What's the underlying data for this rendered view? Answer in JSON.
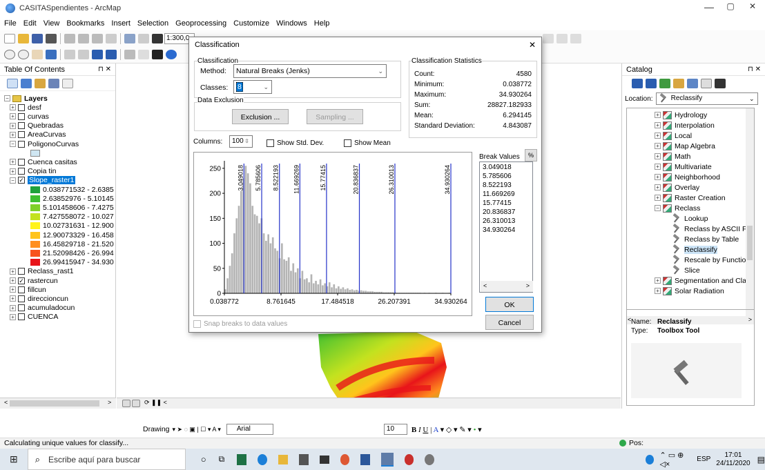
{
  "window": {
    "title": "CASITASpendientes - ArcMap",
    "min": "—",
    "max": "▢",
    "close": "✕"
  },
  "menu": [
    "File",
    "Edit",
    "View",
    "Bookmarks",
    "Insert",
    "Selection",
    "Geoprocessing",
    "Customize",
    "Windows",
    "Help"
  ],
  "toolbar": {
    "scale": "1:300,0"
  },
  "toc": {
    "title": "Table Of Contents",
    "pin": "⊓ ✕",
    "layers_label": "Layers",
    "items": [
      "desf",
      "curvas",
      "Quebradas",
      "AreaCurvas",
      "PoligonoCurvas",
      "Cuenca casitas",
      "Copia tin",
      "Slope_raster1"
    ],
    "legend": [
      {
        "label": "0.038771532 - 2.6385",
        "color": "#1fa23c"
      },
      {
        "label": "2.63852976 - 5.10145",
        "color": "#3fbf31"
      },
      {
        "label": "5.101458606 - 7.4275",
        "color": "#7fd02a"
      },
      {
        "label": "7.427558072 - 10.027",
        "color": "#c3e21f"
      },
      {
        "label": "10.02731631 - 12.900",
        "color": "#fff31a"
      },
      {
        "label": "12.90073329 - 16.458",
        "color": "#ffc41c"
      },
      {
        "label": "16.45829718 - 21.520",
        "color": "#ff8e1f"
      },
      {
        "label": "21.52098426 - 26.994",
        "color": "#f8521d"
      },
      {
        "label": "26.99415947 - 34.930",
        "color": "#e8141a"
      }
    ],
    "more": [
      "Reclass_rast1",
      "rastercun",
      "fillcun",
      "direccioncun",
      "acumuladocun",
      "CUENCA"
    ]
  },
  "dialog": {
    "title": "Classification",
    "close": "✕",
    "classification_group": "Classification",
    "method_label": "Method:",
    "method_value": "Natural Breaks (Jenks)",
    "classes_label": "Classes:",
    "classes_value": "8",
    "exclusion_group": "Data Exclusion",
    "exclusion_btn": "Exclusion ...",
    "sampling_btn": "Sampling ...",
    "stats_group": "Classification Statistics",
    "stats": [
      {
        "k": "Count:",
        "v": "4580"
      },
      {
        "k": "Minimum:",
        "v": "0.038772"
      },
      {
        "k": "Maximum:",
        "v": "34.930264"
      },
      {
        "k": "Sum:",
        "v": "28827.182933"
      },
      {
        "k": "Mean:",
        "v": "6.294145"
      },
      {
        "k": "Standard Deviation:",
        "v": "4.843087"
      }
    ],
    "columns_label": "Columns:",
    "columns_value": "100",
    "show_std_dev": "Show Std. Dev.",
    "show_mean": "Show Mean",
    "break_values_label": "Break Values",
    "pct_btn": "%",
    "break_values": [
      "3.049018",
      "5.785606",
      "8.522193",
      "11.669269",
      "15.77415",
      "20.836837",
      "26.310013",
      "34.930264"
    ],
    "ok": "OK",
    "cancel": "Cancel",
    "snap": "Snap breaks to data values"
  },
  "chart_data": {
    "type": "bar",
    "title": "",
    "xlim": [
      0.038772,
      34.930264
    ],
    "ylim": [
      0,
      265
    ],
    "yticks": [
      "250",
      "200",
      "150",
      "100",
      "50",
      "0"
    ],
    "xticks": [
      "0.038772",
      "8.761645",
      "17.484518",
      "26.207391",
      "34.930264"
    ],
    "breaks": [
      3.049018,
      5.785606,
      8.522193,
      11.669269,
      15.77415,
      20.836837,
      26.310013,
      34.930264
    ],
    "histogram_counts": [
      8,
      30,
      55,
      80,
      120,
      150,
      175,
      205,
      230,
      255,
      240,
      220,
      175,
      158,
      155,
      140,
      150,
      120,
      105,
      118,
      100,
      112,
      90,
      85,
      70,
      100,
      68,
      65,
      72,
      45,
      60,
      42,
      50,
      30,
      45,
      28,
      30,
      22,
      38,
      20,
      25,
      18,
      28,
      16,
      20,
      14,
      22,
      12,
      18,
      10,
      14,
      9,
      12,
      8,
      10,
      7,
      8,
      6,
      7,
      5,
      6,
      5,
      5,
      4,
      4,
      4,
      3,
      3,
      3,
      3,
      2,
      2,
      2,
      2,
      2,
      2,
      1,
      1,
      1,
      1,
      1,
      1,
      1,
      1,
      1,
      1,
      1,
      0,
      1,
      0,
      1,
      0,
      0,
      1,
      0,
      0,
      1,
      0,
      0,
      1
    ]
  },
  "catalog": {
    "title": "Catalog",
    "pin": "⊓ ✕",
    "location_label": "Location:",
    "location_value": "Reclassify",
    "items": [
      {
        "label": "Hydrology",
        "pm": "+",
        "kind": "tb",
        "level": 0
      },
      {
        "label": "Interpolation",
        "pm": "+",
        "kind": "tb",
        "level": 0
      },
      {
        "label": "Local",
        "pm": "+",
        "kind": "tb",
        "level": 0
      },
      {
        "label": "Map Algebra",
        "pm": "+",
        "kind": "tb",
        "level": 0
      },
      {
        "label": "Math",
        "pm": "+",
        "kind": "tb",
        "level": 0
      },
      {
        "label": "Multivariate",
        "pm": "+",
        "kind": "tb",
        "level": 0
      },
      {
        "label": "Neighborhood",
        "pm": "+",
        "kind": "tb",
        "level": 0
      },
      {
        "label": "Overlay",
        "pm": "+",
        "kind": "tb",
        "level": 0
      },
      {
        "label": "Raster Creation",
        "pm": "+",
        "kind": "tb",
        "level": 0
      },
      {
        "label": "Reclass",
        "pm": "−",
        "kind": "tb",
        "level": 0
      },
      {
        "label": "Lookup",
        "pm": "",
        "kind": "tool",
        "level": 1
      },
      {
        "label": "Reclass by ASCII Fil",
        "pm": "",
        "kind": "tool",
        "level": 1
      },
      {
        "label": "Reclass by Table",
        "pm": "",
        "kind": "tool",
        "level": 1
      },
      {
        "label": "Reclassify",
        "pm": "",
        "kind": "tool",
        "level": 1
      },
      {
        "label": "Rescale by Functio",
        "pm": "",
        "kind": "tool",
        "level": 1
      },
      {
        "label": "Slice",
        "pm": "",
        "kind": "tool",
        "level": 1
      },
      {
        "label": "Segmentation and Cla",
        "pm": "+",
        "kind": "tb",
        "level": 0
      },
      {
        "label": "Solar Radiation",
        "pm": "+",
        "kind": "tb",
        "level": 0
      }
    ],
    "name_label": "Name:",
    "name_value": "Reclassify",
    "type_label": "Type:",
    "type_value": "Toolbox Tool"
  },
  "drawbar": {
    "drawing": "Drawing",
    "font": "Arial",
    "size": "10"
  },
  "status": {
    "message": "Calculating unique values for classify...",
    "pos": "Pos:"
  },
  "taskbar": {
    "search": "Escribe aquí para buscar",
    "lang": "ESP",
    "time": "17:01",
    "date": "24/11/2020"
  }
}
